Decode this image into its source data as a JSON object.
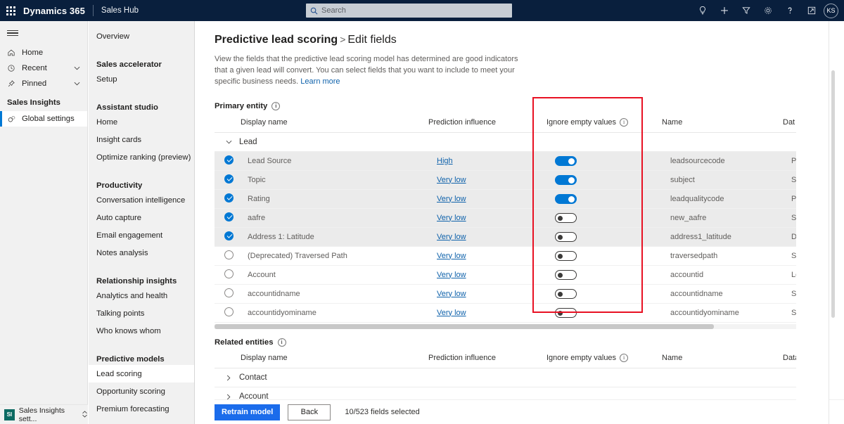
{
  "header": {
    "waffle_name": "app-launcher",
    "brand": "Dynamics 365",
    "app_name": "Sales Hub",
    "search_placeholder": "Search",
    "search_value": "",
    "avatar_initials": "KS",
    "icons": [
      {
        "name": "insights-lightbulb-icon",
        "label": "Insights"
      },
      {
        "name": "quick-create-plus-icon",
        "label": "New"
      },
      {
        "name": "filter-icon",
        "label": "Filter"
      },
      {
        "name": "settings-gear-icon",
        "label": "Settings"
      },
      {
        "name": "help-question-icon",
        "label": "Help"
      },
      {
        "name": "assistant-icon",
        "label": "Assistant"
      }
    ]
  },
  "nav_primary": {
    "hamburger_label": "Show/Hide navigation",
    "items": [
      {
        "label": "Home",
        "icon": "home-icon",
        "chevron": false
      },
      {
        "label": "Recent",
        "icon": "clock-icon",
        "chevron": true
      },
      {
        "label": "Pinned",
        "icon": "pin-icon",
        "chevron": true
      }
    ],
    "group": "Sales Insights",
    "group_items": [
      {
        "label": "Global settings",
        "icon": "global-settings-icon",
        "selected": true
      }
    ],
    "footer": {
      "badge": "SI",
      "label": "Sales Insights sett...",
      "chevron": "⌃"
    }
  },
  "nav_secondary": {
    "items": [
      {
        "label": "Overview",
        "type": "link"
      },
      {
        "label": "Sales accelerator",
        "type": "group"
      },
      {
        "label": "Setup",
        "type": "link"
      },
      {
        "label": "Assistant studio",
        "type": "group"
      },
      {
        "label": "Home",
        "type": "link"
      },
      {
        "label": "Insight cards",
        "type": "link"
      },
      {
        "label": "Optimize ranking (preview)",
        "type": "link"
      },
      {
        "label": "Productivity",
        "type": "group"
      },
      {
        "label": "Conversation intelligence",
        "type": "link"
      },
      {
        "label": "Auto capture",
        "type": "link"
      },
      {
        "label": "Email engagement",
        "type": "link"
      },
      {
        "label": "Notes analysis",
        "type": "link"
      },
      {
        "label": "Relationship insights",
        "type": "group"
      },
      {
        "label": "Analytics and health",
        "type": "link"
      },
      {
        "label": "Talking points",
        "type": "link"
      },
      {
        "label": "Who knows whom",
        "type": "link"
      },
      {
        "label": "Predictive models",
        "type": "group"
      },
      {
        "label": "Lead scoring",
        "type": "link",
        "selected": true
      },
      {
        "label": "Opportunity scoring",
        "type": "link"
      },
      {
        "label": "Premium forecasting",
        "type": "link"
      }
    ]
  },
  "page": {
    "title": "Predictive lead scoring",
    "title_separator": ">",
    "subtitle": "Edit fields",
    "description": "View the fields that the predictive lead scoring model has determined are good indicators that a given lead will convert. You can select fields that you want to include to meet your specific business needs.",
    "learn_more": "Learn more"
  },
  "primary_entity": {
    "section_label": "Primary entity",
    "columns": {
      "display_name": "Display name",
      "prediction_influence": "Prediction influence",
      "ignore_empty_values": "Ignore empty values",
      "name": "Name",
      "data_type": "Dat"
    },
    "group": {
      "label": "Lead",
      "expanded": true
    },
    "rows": [
      {
        "selected": true,
        "display_name": "Lead Source",
        "influence": "High",
        "ignore_empty": true,
        "name": "leadsourcecode",
        "data_type": "Pick"
      },
      {
        "selected": true,
        "display_name": "Topic",
        "influence": "Very low",
        "ignore_empty": true,
        "name": "subject",
        "data_type": "Strin"
      },
      {
        "selected": true,
        "display_name": "Rating",
        "influence": "Very low",
        "ignore_empty": true,
        "name": "leadqualitycode",
        "data_type": "Pick"
      },
      {
        "selected": true,
        "display_name": "aafre",
        "influence": "Very low",
        "ignore_empty": false,
        "name": "new_aafre",
        "data_type": "Strin"
      },
      {
        "selected": true,
        "display_name": "Address 1: Latitude",
        "influence": "Very low",
        "ignore_empty": false,
        "name": "address1_latitude",
        "data_type": "Dou"
      },
      {
        "selected": false,
        "display_name": "(Deprecated) Traversed Path",
        "influence": "Very low",
        "ignore_empty": false,
        "name": "traversedpath",
        "data_type": "Strin"
      },
      {
        "selected": false,
        "display_name": "Account",
        "influence": "Very low",
        "ignore_empty": false,
        "name": "accountid",
        "data_type": "Loo"
      },
      {
        "selected": false,
        "display_name": "accountidname",
        "influence": "Very low",
        "ignore_empty": false,
        "name": "accountidname",
        "data_type": "Strin"
      },
      {
        "selected": false,
        "display_name": "accountidyominame",
        "influence": "Very low",
        "ignore_empty": false,
        "name": "accountidyominame",
        "data_type": "Strin"
      }
    ]
  },
  "related_entities": {
    "section_label": "Related entities",
    "columns": {
      "display_name": "Display name",
      "prediction_influence": "Prediction influence",
      "ignore_empty_values": "Ignore empty values",
      "name": "Name",
      "data_type": "Data t"
    },
    "groups": [
      {
        "label": "Contact",
        "expanded": false
      },
      {
        "label": "Account",
        "expanded": false
      }
    ]
  },
  "footer": {
    "retrain_label": "Retrain model",
    "back_label": "Back",
    "selection_status": "10/523 fields selected"
  },
  "annotation": {
    "highlight_color": "#e81123",
    "highlight_target": "ignore-empty-values-column"
  }
}
